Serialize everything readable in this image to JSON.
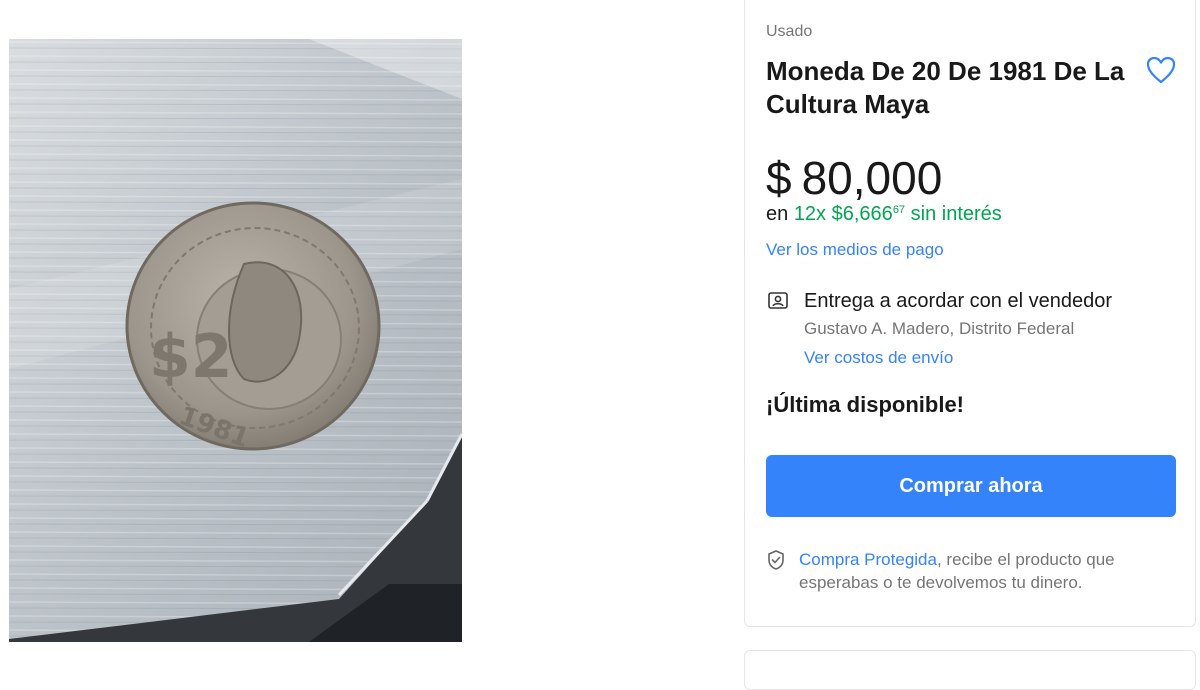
{
  "product": {
    "condition": "Usado",
    "title": "Moneda De 20 De 1981 De La Cultura Maya",
    "favorite_icon": "heart-outline-icon",
    "image_alt": "moneda-20-pesos-1981-cultura-maya-photo"
  },
  "price": {
    "currency": "$",
    "amount": "80,000",
    "installments_prefix": "en",
    "installments_count": "12x",
    "installment_currency": "$",
    "installment_amount": "6,666",
    "installment_cents": "67",
    "installments_suffix": "sin interés",
    "payment_methods_link": "Ver los medios de pago"
  },
  "shipping": {
    "icon": "location-person-icon",
    "title": "Entrega a acordar con el vendedor",
    "location": "Gustavo A. Madero, Distrito Federal",
    "costs_link": "Ver costos de envío"
  },
  "stock": {
    "label": "¡Última disponible!"
  },
  "actions": {
    "buy_now": "Comprar ahora"
  },
  "protection": {
    "icon": "shield-check-icon",
    "link": "Compra Protegida",
    "text": ", recibe el producto que esperabas o te devolvemos tu dinero."
  },
  "colors": {
    "accent": "#3483fa",
    "success": "#00a650"
  }
}
